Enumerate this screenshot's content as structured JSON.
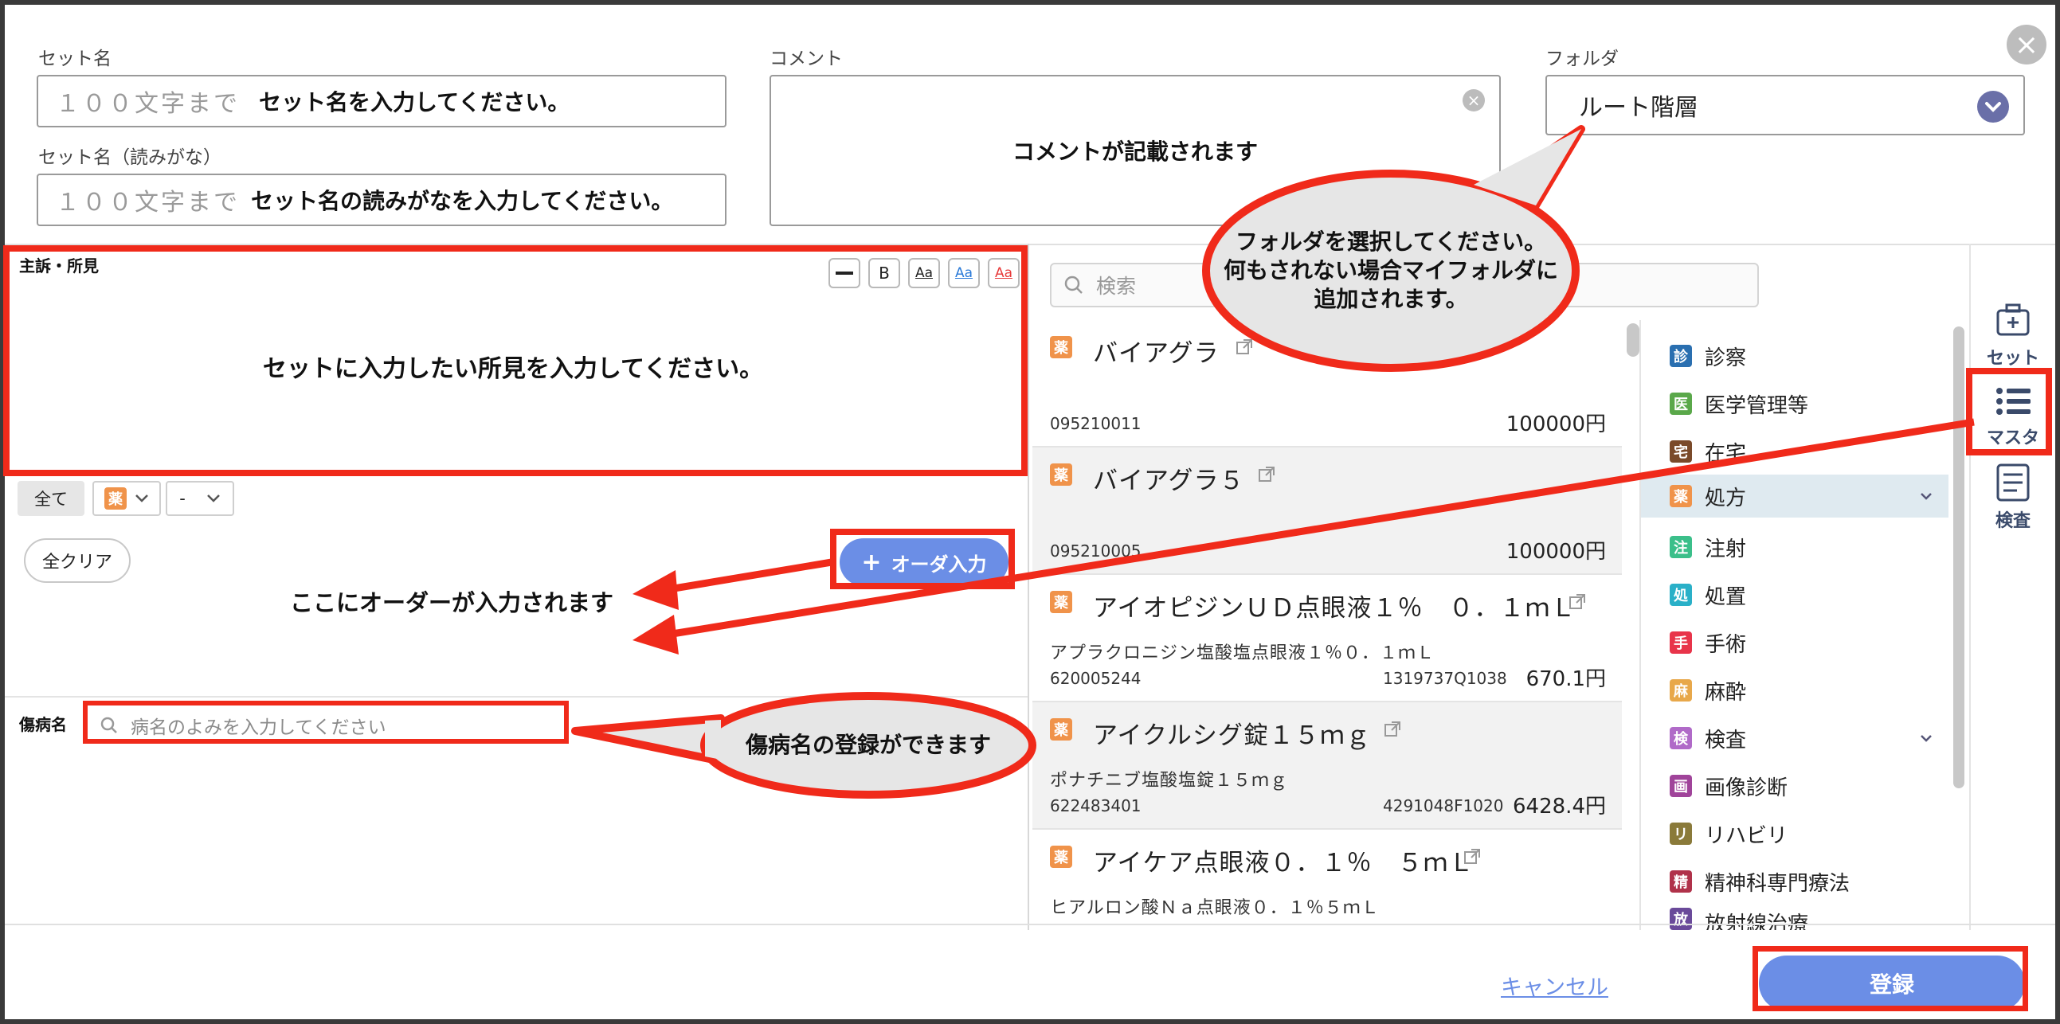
{
  "form": {
    "set_name_label": "セット名",
    "set_name_placeholder": "１００文字まで",
    "set_name_value": "セット名を入力してください。",
    "reading_label": "セット名（読みがな）",
    "reading_placeholder": "１００文字まで",
    "reading_value": "セット名の読みがなを入力してください。",
    "comment_label": "コメント",
    "comment_value": "コメントが記載されます",
    "folder_label": "フォルダ",
    "folder_value": "ルート階層"
  },
  "findings": {
    "label": "主訴・所見",
    "value": "セットに入力したい所見を入力してください。",
    "toolbar": [
      "B",
      "Aa",
      "Aa",
      "Aa"
    ]
  },
  "filters": {
    "all_label": "全て",
    "type_badge": "薬",
    "dash_value": "-"
  },
  "orders": {
    "clear_label": "全クリア",
    "order_input_label": "オーダ入力",
    "order_hint": "ここにオーダーが入力されます"
  },
  "disease": {
    "label": "傷病名",
    "placeholder": "病名のよみを入力してください"
  },
  "search": {
    "placeholder": "検索"
  },
  "drugs": [
    {
      "badge": "薬",
      "name": "バイアグラ",
      "generic": "",
      "code": "095210011",
      "code2": "",
      "price": "100000円"
    },
    {
      "badge": "薬",
      "name": "バイアグラ５",
      "generic": "",
      "code": "095210005",
      "code2": "",
      "price": "100000円"
    },
    {
      "badge": "薬",
      "name": "アイオピジンＵＤ点眼液１％　０．１ｍＬ",
      "generic": "アプラクロニジン塩酸塩点眼液１％０．１ｍＬ",
      "code": "620005244",
      "code2": "1319737Q1038",
      "price": "670.1円"
    },
    {
      "badge": "薬",
      "name": "アイクルシグ錠１５ｍｇ",
      "generic": "ポナチニブ塩酸塩錠１５ｍｇ",
      "code": "622483401",
      "code2": "4291048F1020",
      "price": "6428.4円"
    },
    {
      "badge": "薬",
      "name": "アイケア点眼液０．１％　５ｍＬ",
      "generic": "ヒアルロン酸Ｎａ点眼液０．１％５ｍＬ",
      "code": "",
      "code2": "",
      "price": ""
    }
  ],
  "categories": [
    {
      "badge": "診",
      "label": "診察",
      "color": "#2a6fb0"
    },
    {
      "badge": "医",
      "label": "医学管理等",
      "color": "#5aa84a"
    },
    {
      "badge": "宅",
      "label": "在宅",
      "color": "#7a4a2a"
    },
    {
      "badge": "薬",
      "label": "処方",
      "color": "#f0934a"
    },
    {
      "badge": "注",
      "label": "注射",
      "color": "#3bbf8a"
    },
    {
      "badge": "処",
      "label": "処置",
      "color": "#2ab0c8"
    },
    {
      "badge": "手",
      "label": "手術",
      "color": "#e8344a"
    },
    {
      "badge": "麻",
      "label": "麻酔",
      "color": "#e8a84a"
    },
    {
      "badge": "検",
      "label": "検査",
      "color": "#b06ac8"
    },
    {
      "badge": "画",
      "label": "画像診断",
      "color": "#a0449a"
    },
    {
      "badge": "リ",
      "label": "リハビリ",
      "color": "#8a7a3a"
    },
    {
      "badge": "精",
      "label": "精神科専門療法",
      "color": "#b0324a"
    },
    {
      "badge": "放",
      "label": "放射線治療",
      "color": "#6a4a9a"
    }
  ],
  "side_tabs": {
    "set": "セット",
    "master": "マスタ",
    "exam": "検査"
  },
  "footer": {
    "cancel": "キャンセル",
    "register": "登録"
  },
  "callouts": {
    "folder_line1": "フォルダを選択してください。",
    "folder_line2": "何もされない場合マイフォルダに",
    "folder_line3": "追加されます。",
    "disease": "傷病名の登録ができます"
  },
  "colors": {
    "accent": "#6b8ee6",
    "highlight": "#f02a1a",
    "selected_row": "#dfeaf0",
    "drug_badge": "#f0934a"
  }
}
